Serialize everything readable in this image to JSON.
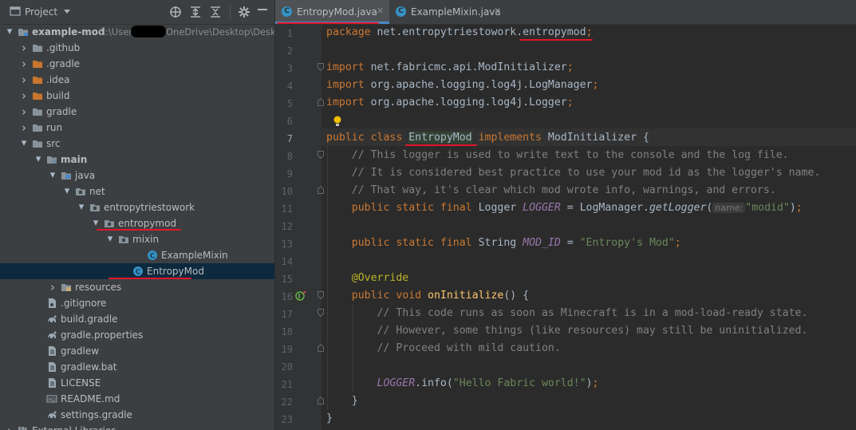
{
  "project": {
    "title": "Project",
    "tree": [
      {
        "label": "example-mod",
        "path": "C:\\User",
        "path2": "OneDrive\\Desktop\\Deskto",
        "icon": "module-folder-icon",
        "arrow": "down",
        "depth": 0,
        "bold": true
      },
      {
        "label": ".github",
        "icon": "folder-icon",
        "arrow": "right",
        "depth": 1
      },
      {
        "label": ".gradle",
        "icon": "orange-folder-icon",
        "arrow": "right",
        "depth": 1
      },
      {
        "label": ".idea",
        "icon": "orange-folder-icon",
        "arrow": "right",
        "depth": 1
      },
      {
        "label": "build",
        "icon": "orange-folder-icon",
        "arrow": "right",
        "depth": 1
      },
      {
        "label": "gradle",
        "icon": "folder-icon",
        "arrow": "right",
        "depth": 1
      },
      {
        "label": "run",
        "icon": "folder-icon",
        "arrow": "right",
        "depth": 1
      },
      {
        "label": "src",
        "icon": "folder-icon",
        "arrow": "down",
        "depth": 1
      },
      {
        "label": "main",
        "icon": "source-folder-icon",
        "arrow": "down",
        "depth": 2,
        "bold": true
      },
      {
        "label": "java",
        "icon": "source-root-icon",
        "arrow": "down",
        "depth": 3
      },
      {
        "label": "net",
        "icon": "package-icon",
        "arrow": "down",
        "depth": 4
      },
      {
        "label": "entropytriestowork",
        "icon": "package-icon",
        "arrow": "down",
        "depth": 5
      },
      {
        "label": "entropymod",
        "icon": "package-icon",
        "arrow": "down",
        "depth": 6
      },
      {
        "label": "mixin",
        "icon": "package-icon",
        "arrow": "down",
        "depth": 7
      },
      {
        "label": "ExampleMixin",
        "icon": "class-icon",
        "arrow": "",
        "depth": 9
      },
      {
        "label": "EntropyMod",
        "icon": "class-icon",
        "arrow": "",
        "depth": 8,
        "selected": true
      },
      {
        "label": "resources",
        "icon": "resources-folder-icon",
        "arrow": "right",
        "depth": 3
      },
      {
        "label": ".gitignore",
        "icon": "gitignore-file-icon",
        "arrow": "",
        "depth": 2
      },
      {
        "label": "build.gradle",
        "icon": "gradle-file-icon",
        "arrow": "",
        "depth": 2
      },
      {
        "label": "gradle.properties",
        "icon": "gradle-file-icon",
        "arrow": "",
        "depth": 2
      },
      {
        "label": "gradlew",
        "icon": "text-file-icon",
        "arrow": "",
        "depth": 2
      },
      {
        "label": "gradlew.bat",
        "icon": "text-file-icon",
        "arrow": "",
        "depth": 2
      },
      {
        "label": "LICENSE",
        "icon": "text-file-icon",
        "arrow": "",
        "depth": 2
      },
      {
        "label": "README.md",
        "icon": "markdown-file-icon",
        "arrow": "",
        "depth": 2
      },
      {
        "label": "settings.gradle",
        "icon": "gradle-file-icon",
        "arrow": "",
        "depth": 2
      },
      {
        "label": "External Libraries",
        "icon": "library-icon",
        "arrow": "right",
        "depth": 0
      }
    ]
  },
  "tabs": [
    {
      "label": "EntropyMod.java",
      "active": true
    },
    {
      "label": "ExampleMixin.java",
      "active": false
    }
  ],
  "editor": {
    "current_line": 7,
    "lines": [
      [
        [
          "kw",
          "package "
        ],
        [
          "",
          "net.entropytriestowork."
        ],
        [
          "",
          "entropymod"
        ],
        [
          "kw",
          ";"
        ]
      ],
      [],
      [
        [
          "kw",
          "import "
        ],
        [
          "",
          "net.fabricmc.api.ModInitializer"
        ],
        [
          "kw",
          ";"
        ]
      ],
      [
        [
          "kw",
          "import "
        ],
        [
          "",
          "org.apache.logging.log4j.LogManager"
        ],
        [
          "kw",
          ";"
        ]
      ],
      [
        [
          "kw",
          "import "
        ],
        [
          "",
          "org.apache.logging.log4j.Logger"
        ],
        [
          "kw",
          ";"
        ]
      ],
      [],
      [
        [
          "kw",
          "public class "
        ],
        [
          "idhl",
          "EntropyMod"
        ],
        [
          "kw",
          " implements "
        ],
        [
          "",
          "ModInitializer {"
        ]
      ],
      [
        [
          "",
          "    "
        ],
        [
          "cm",
          "// This logger is used to write text to the console and the log file."
        ]
      ],
      [
        [
          "",
          "    "
        ],
        [
          "cm",
          "// It is considered best practice to use your mod id as the logger's name."
        ]
      ],
      [
        [
          "",
          "    "
        ],
        [
          "cm",
          "// That way, it's clear which mod wrote info, warnings, and errors."
        ]
      ],
      [
        [
          "",
          "    "
        ],
        [
          "kw",
          "public static final "
        ],
        [
          "",
          "Logger "
        ],
        [
          "stf",
          "LOGGER"
        ],
        [
          "",
          " = LogManager."
        ],
        [
          "mcall",
          "getLogger"
        ],
        [
          "",
          "("
        ],
        [
          "hint",
          "name:"
        ],
        [
          "str",
          "\"modid\""
        ],
        [
          "",
          ")"
        ],
        [
          "kw",
          ";"
        ]
      ],
      [],
      [
        [
          "",
          "    "
        ],
        [
          "kw",
          "public static final "
        ],
        [
          "",
          "String "
        ],
        [
          "stf",
          "MOD_ID"
        ],
        [
          "",
          " = "
        ],
        [
          "str",
          "\"Entropy's Mod\""
        ],
        [
          "kw",
          ";"
        ]
      ],
      [],
      [
        [
          "",
          "    "
        ],
        [
          "ann",
          "@Override"
        ]
      ],
      [
        [
          "",
          "    "
        ],
        [
          "kw",
          "public void "
        ],
        [
          "mdecl",
          "onInitialize"
        ],
        [
          "",
          "() {"
        ]
      ],
      [
        [
          "",
          "        "
        ],
        [
          "cm",
          "// This code runs as soon as Minecraft is in a mod-load-ready state."
        ]
      ],
      [
        [
          "",
          "        "
        ],
        [
          "cm",
          "// However, some things (like resources) may still be uninitialized."
        ]
      ],
      [
        [
          "",
          "        "
        ],
        [
          "cm",
          "// Proceed with mild caution."
        ]
      ],
      [],
      [
        [
          "",
          "        "
        ],
        [
          "stf",
          "LOGGER"
        ],
        [
          "",
          ".info("
        ],
        [
          "str",
          "\"Hello Fabric world!\""
        ],
        [
          "",
          ")"
        ],
        [
          "kw",
          ";"
        ]
      ],
      [
        [
          "",
          "    }"
        ]
      ],
      [
        [
          "",
          "}"
        ]
      ]
    ]
  },
  "colors": {
    "accent": "#3592c4",
    "annotation_red": "#e0162b",
    "selection": "#0d293e"
  }
}
